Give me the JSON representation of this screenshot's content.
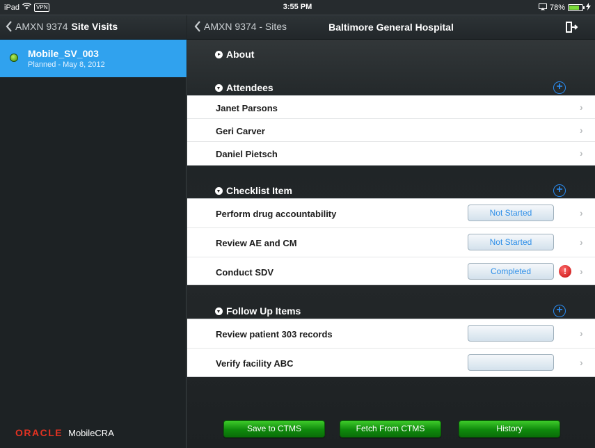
{
  "status_bar": {
    "device": "iPad",
    "vpn": "VPN",
    "time": "3:55 PM",
    "battery": "78%",
    "battery_level": 0.78
  },
  "left_pane": {
    "back_label": "AMXN 9374",
    "title": "Site Visits",
    "visit": {
      "name": "Mobile_SV_003",
      "subtitle": "Planned - May 8, 2012"
    },
    "brand": "ORACLE",
    "product": "MobileCRA"
  },
  "right_pane": {
    "back_label": "AMXN 9374 - Sites",
    "title": "Baltimore General Hospital",
    "sections": {
      "about": {
        "title": "About"
      },
      "attendees": {
        "title": "Attendees",
        "add_symbol": "+",
        "items": [
          "Janet Parsons",
          "Geri Carver",
          "Daniel Pietsch"
        ]
      },
      "checklist": {
        "title": "Checklist Item",
        "add_symbol": "+",
        "items": [
          {
            "label": "Perform drug accountability",
            "status": "Not Started",
            "alert": ""
          },
          {
            "label": "Review AE and CM",
            "status": "Not Started",
            "alert": ""
          },
          {
            "label": "Conduct SDV",
            "status": "Completed",
            "alert": "!"
          }
        ]
      },
      "follow_up": {
        "title": "Follow Up Items",
        "add_symbol": "+",
        "items": [
          {
            "label": "Review patient 303 records",
            "status": ""
          },
          {
            "label": "Verify facility ABC",
            "status": ""
          }
        ]
      }
    },
    "chevron": "›",
    "buttons": {
      "save": "Save to CTMS",
      "fetch": "Fetch From CTMS",
      "history": "History"
    }
  },
  "colors": {
    "selection": "#30a2ee",
    "accent": "#2a8bf0",
    "button_green": "#0f8a0c",
    "brand_red": "#e33222"
  }
}
